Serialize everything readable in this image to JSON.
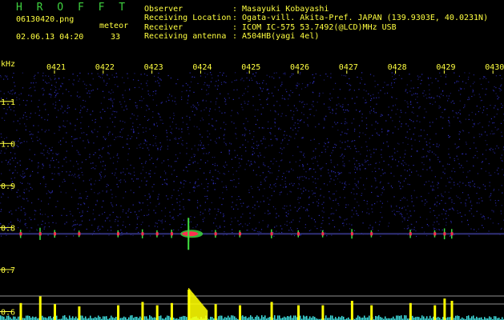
{
  "header": {
    "app_name": "H R O F F T",
    "filename": "06130420.png",
    "datetime": "02.06.13 04:20",
    "count_label": "meteor",
    "count_value": "33",
    "info": [
      {
        "label": "Observer",
        "value": ": Masayuki Kobayashi"
      },
      {
        "label": "Receiving Location",
        "value": ": Ogata-vill. Akita-Pref. JAPAN (139.9303E, 40.0231N)"
      },
      {
        "label": "Receiver",
        "value": ": ICOM IC-575 53.7492(@LCD)MHz USB"
      },
      {
        "label": "Receiving antenna",
        "value": ": A504HB(yagi 4el)"
      }
    ]
  },
  "colors": {
    "app_name": "#3fd23f",
    "text": "#ffff40",
    "background": "#000000",
    "noise": "#1a1a8c",
    "echo_hot": "#ff3050",
    "echo_warm": "#40e040",
    "count_bars": "#ffff00",
    "count_noise": "#40e0e0"
  },
  "chart_data": {
    "type": "heatmap",
    "title": "",
    "ylabel": "kHz",
    "y_ticks": [
      "1.1",
      "1.0",
      "0.9",
      "0.8",
      "0.7",
      "0.6"
    ],
    "x_ticks": [
      "0421",
      "0422",
      "0423",
      "0424",
      "0425",
      "0426",
      "0427",
      "0428",
      "0429",
      "0430"
    ],
    "ylim": [
      0.58,
      1.17
    ],
    "carrier_khz": 0.785,
    "meteor_echoes": [
      {
        "time_min": 0.3,
        "strength": 0.4
      },
      {
        "time_min": 0.7,
        "strength": 0.7
      },
      {
        "time_min": 1.0,
        "strength": 0.35
      },
      {
        "time_min": 1.5,
        "strength": 0.25
      },
      {
        "time_min": 2.3,
        "strength": 0.3
      },
      {
        "time_min": 2.8,
        "strength": 0.45
      },
      {
        "time_min": 3.1,
        "strength": 0.3
      },
      {
        "time_min": 3.4,
        "strength": 0.4
      },
      {
        "time_min": 3.75,
        "strength": 1.0
      },
      {
        "time_min": 4.3,
        "strength": 0.35
      },
      {
        "time_min": 4.8,
        "strength": 0.3
      },
      {
        "time_min": 5.45,
        "strength": 0.45
      },
      {
        "time_min": 6.0,
        "strength": 0.3
      },
      {
        "time_min": 6.5,
        "strength": 0.3
      },
      {
        "time_min": 7.1,
        "strength": 0.5
      },
      {
        "time_min": 7.5,
        "strength": 0.3
      },
      {
        "time_min": 8.3,
        "strength": 0.4
      },
      {
        "time_min": 8.8,
        "strength": 0.3
      },
      {
        "time_min": 9.0,
        "strength": 0.6
      },
      {
        "time_min": 9.15,
        "strength": 0.5
      }
    ],
    "grid": false
  }
}
